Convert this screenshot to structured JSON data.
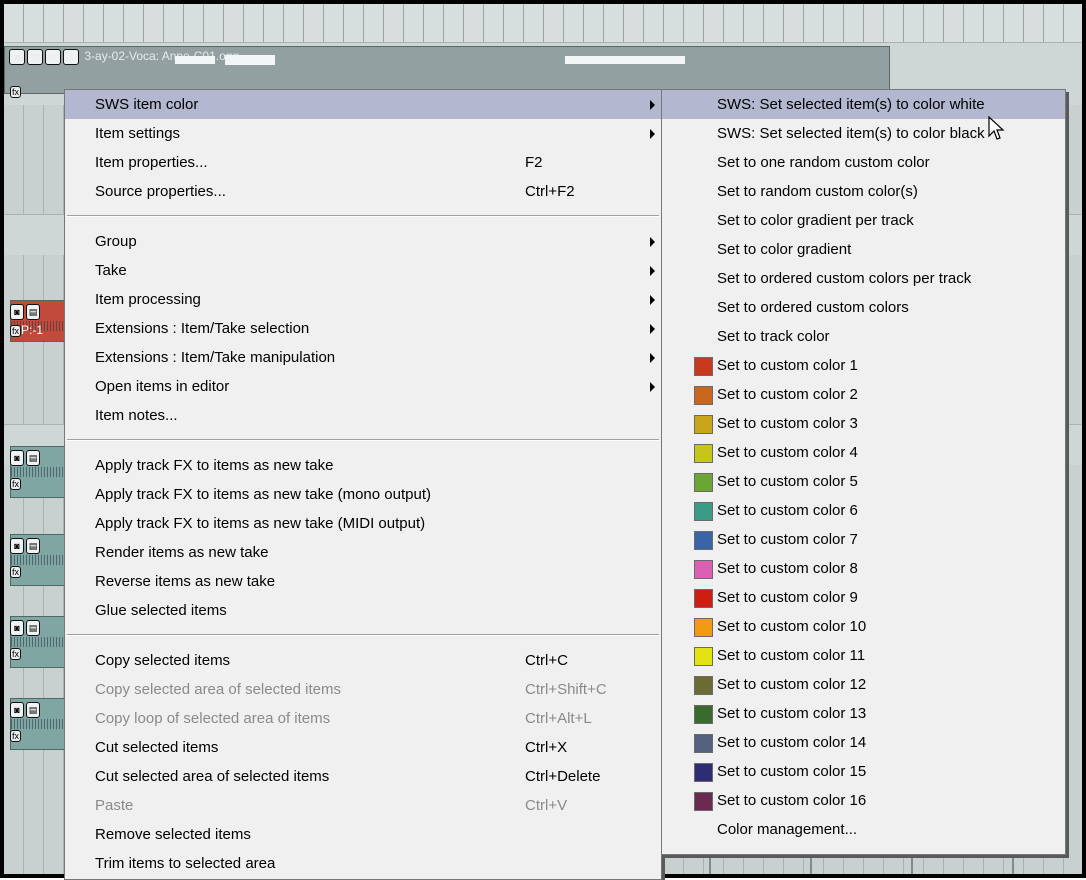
{
  "background": {
    "item_title": "3-ay-02-Voca: Anne-C01.ogg",
    "track_button_glyphs": [
      "◙",
      "▤",
      "m",
      "i"
    ],
    "fx_label": "fx",
    "track_label_fragment": "P:-1"
  },
  "menu": {
    "groups": [
      [
        {
          "label": "SWS item color",
          "submenu": true,
          "highlighted": true
        },
        {
          "label": "Item settings",
          "submenu": true
        },
        {
          "label": "Item properties...",
          "shortcut": "F2"
        },
        {
          "label": "Source properties...",
          "shortcut": "Ctrl+F2"
        }
      ],
      [
        {
          "label": "Group",
          "submenu": true
        },
        {
          "label": "Take",
          "submenu": true
        },
        {
          "label": "Item processing",
          "submenu": true
        },
        {
          "label": "Extensions : Item/Take selection",
          "submenu": true
        },
        {
          "label": "Extensions : Item/Take manipulation",
          "submenu": true
        },
        {
          "label": "Open items in editor",
          "submenu": true
        },
        {
          "label": "Item notes..."
        }
      ],
      [
        {
          "label": "Apply track FX to items as new take"
        },
        {
          "label": "Apply track FX to items as new take (mono output)"
        },
        {
          "label": "Apply track FX to items as new take (MIDI output)"
        },
        {
          "label": "Render items as new take"
        },
        {
          "label": "Reverse items as new take"
        },
        {
          "label": "Glue selected items"
        }
      ],
      [
        {
          "label": "Copy selected items",
          "shortcut": "Ctrl+C"
        },
        {
          "label": "Copy selected area of selected items",
          "shortcut": "Ctrl+Shift+C",
          "disabled": true
        },
        {
          "label": "Copy loop of selected area of items",
          "shortcut": "Ctrl+Alt+L",
          "disabled": true
        },
        {
          "label": "Cut selected items",
          "shortcut": "Ctrl+X"
        },
        {
          "label": "Cut selected area of selected items",
          "shortcut": "Ctrl+Delete"
        },
        {
          "label": "Paste",
          "shortcut": "Ctrl+V",
          "disabled": true
        },
        {
          "label": "Remove selected items"
        },
        {
          "label": "Trim items to selected area"
        }
      ]
    ]
  },
  "submenu": {
    "items": [
      {
        "label": "SWS: Set selected item(s) to color white",
        "highlighted": true
      },
      {
        "label": "SWS: Set selected item(s) to color black"
      },
      {
        "label": "Set to one random custom color"
      },
      {
        "label": "Set to random custom color(s)"
      },
      {
        "label": "Set to color gradient per track"
      },
      {
        "label": "Set to color gradient"
      },
      {
        "label": "Set to ordered custom colors per track"
      },
      {
        "label": "Set to ordered custom colors"
      },
      {
        "label": "Set to track color"
      },
      {
        "label": "Set to custom color 1",
        "color": "#c8391e"
      },
      {
        "label": "Set to custom color 2",
        "color": "#c8661e"
      },
      {
        "label": "Set to custom color 3",
        "color": "#c9a51b"
      },
      {
        "label": "Set to custom color 4",
        "color": "#c4c41b"
      },
      {
        "label": "Set to custom color 5",
        "color": "#6aa535"
      },
      {
        "label": "Set to custom color 6",
        "color": "#3a9b87"
      },
      {
        "label": "Set to custom color 7",
        "color": "#3a64a8"
      },
      {
        "label": "Set to custom color 8",
        "color": "#d95fb2"
      },
      {
        "label": "Set to custom color 9",
        "color": "#cc1f12"
      },
      {
        "label": "Set to custom color 10",
        "color": "#f29b12"
      },
      {
        "label": "Set to custom color 11",
        "color": "#e3e212"
      },
      {
        "label": "Set to custom color 12",
        "color": "#6b6b34"
      },
      {
        "label": "Set to custom color 13",
        "color": "#3b6b2c"
      },
      {
        "label": "Set to custom color 14",
        "color": "#53617f"
      },
      {
        "label": "Set to custom color 15",
        "color": "#2e2d74"
      },
      {
        "label": "Set to custom color 16",
        "color": "#6b2a4f"
      },
      {
        "label": "Color management..."
      }
    ]
  }
}
